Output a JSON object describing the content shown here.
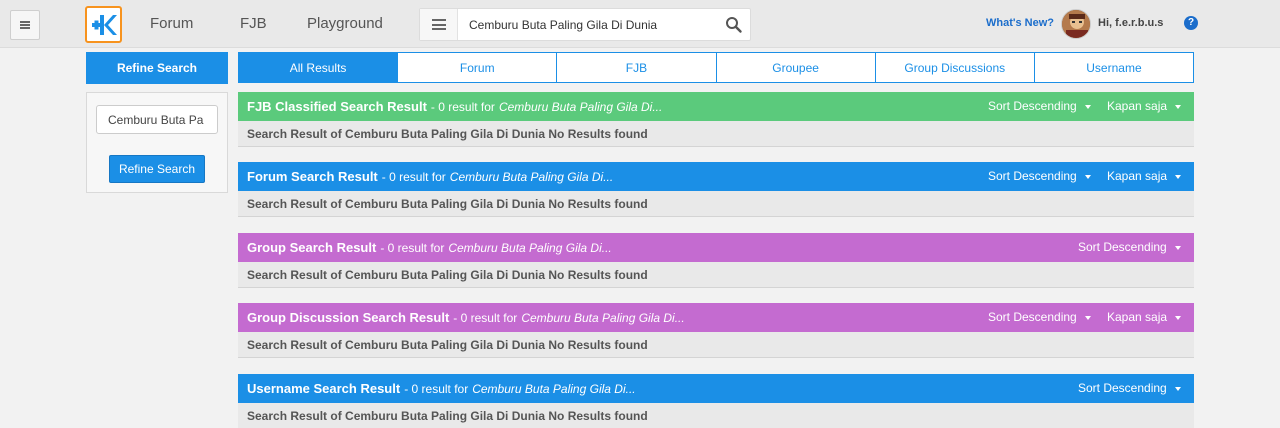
{
  "header": {
    "nav": [
      "Forum",
      "FJB",
      "Playground"
    ],
    "search_value": "Cemburu Buta Paling Gila Di Dunia",
    "whats_new": "What's New?",
    "greeting": "Hi, f.e.r.b.u.s",
    "help": "?"
  },
  "sidebar": {
    "title": "Refine Search",
    "input_value": "Cemburu Buta Pa",
    "button_label": "Refine Search"
  },
  "tabs": [
    "All Results",
    "Forum",
    "FJB",
    "Groupee",
    "Group Discussions",
    "Username"
  ],
  "active_tab": "All Results",
  "colors": {
    "green": "#5bca7c",
    "blue": "#1b8fe6",
    "purple": "#c46bd0"
  },
  "sections": [
    {
      "title": "FJB Classified Search Result",
      "count": "- 0 result for",
      "query": "Cemburu Buta Paling Gila Di...",
      "sort": "Sort Descending",
      "time": "Kapan saja",
      "body": "Search Result of Cemburu Buta Paling Gila Di Dunia No Results found"
    },
    {
      "title": "Forum Search Result",
      "count": "- 0 result for",
      "query": "Cemburu Buta Paling Gila Di...",
      "sort": "Sort Descending",
      "time": "Kapan saja",
      "body": "Search Result of Cemburu Buta Paling Gila Di Dunia No Results found"
    },
    {
      "title": "Group Search Result",
      "count": "- 0 result for",
      "query": "Cemburu Buta Paling Gila Di...",
      "sort": "Sort Descending",
      "body": "Search Result of Cemburu Buta Paling Gila Di Dunia No Results found"
    },
    {
      "title": "Group Discussion Search Result",
      "count": "- 0 result for",
      "query": "Cemburu Buta Paling Gila Di...",
      "sort": "Sort Descending",
      "time": "Kapan saja",
      "body": "Search Result of Cemburu Buta Paling Gila Di Dunia No Results found"
    },
    {
      "title": "Username Search Result",
      "count": "- 0 result for",
      "query": "Cemburu Buta Paling Gila Di...",
      "sort": "Sort Descending",
      "body": "Search Result of Cemburu Buta Paling Gila Di Dunia No Results found"
    }
  ]
}
